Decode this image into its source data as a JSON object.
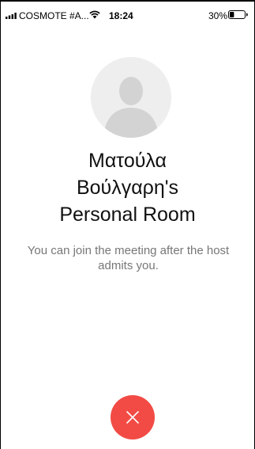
{
  "status_bar": {
    "carrier": "COSMOTE #A...",
    "time": "18:24",
    "battery_percent_label": "30%",
    "battery_level": 0.3,
    "icons": [
      "signal-icon",
      "wifi-icon",
      "battery-icon"
    ]
  },
  "meeting": {
    "host_avatar": "default-avatar-icon",
    "title_line1": "Ματούλα",
    "title_line2": "Βούλγαρη's",
    "title_line3": "Personal Room",
    "message": "You can join the meeting after the host admits you."
  },
  "actions": {
    "leave_icon": "close-icon",
    "leave_color": "#f24b45"
  }
}
